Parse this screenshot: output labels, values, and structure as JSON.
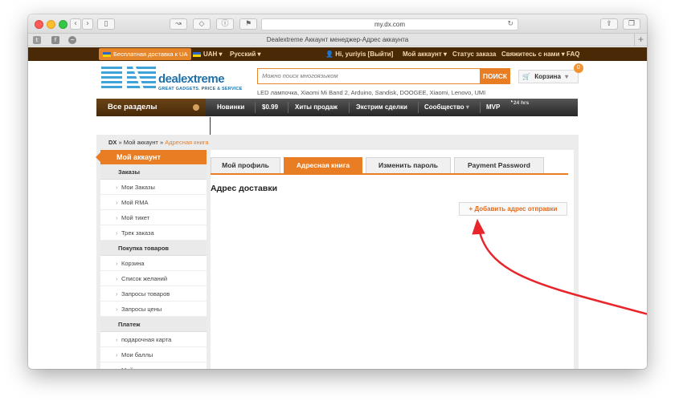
{
  "browser": {
    "url": "my.dx.com",
    "tab_title": "Dealextreme Аккаунт менеджер-Адрес аккаунта",
    "new_tab": "+"
  },
  "topbar": {
    "free_shipping": "Бесплатная доставка к UA",
    "currency": "UAH ▾",
    "language": "Русский ▾",
    "greeting": "Hi, yuriyis [Выйти]",
    "my_account": "Мой аккаунт ▾",
    "order_status": "Статус заказа",
    "contact": "Свяжитесь с нами ▾",
    "faq": "FAQ"
  },
  "header": {
    "logo_main": "dealextreme",
    "logo_sub": "GREAT GADGETS. PRICE & SERVICE",
    "search_placeholder": "Можно поиск многоязыком",
    "search_button": "ПОИСК",
    "keywords": "LED лампочка, Xiaomi Mi Band 2, Arduino, Sandisk, DOOGEE, Xiaomi, Lenovo, UMI",
    "cart_label": "Корзина",
    "cart_count": "0"
  },
  "nav": {
    "all_categories": "Все разделы",
    "items": [
      "Новинки",
      "$0.99",
      "Хиты продаж",
      "Экстрим сделки",
      "Сообщество",
      "MVP"
    ],
    "hours": "24 hrs"
  },
  "breadcrumb": {
    "home": "DX",
    "sep": "»",
    "account": "Мой аккаунт",
    "current": "Адресная книга"
  },
  "sidebar": {
    "title": "Мой аккаунт",
    "sections": [
      {
        "title": "Заказы",
        "items": [
          "Мои Заказы",
          "Мой RMA",
          "Мой тикет",
          "Трек заказа"
        ]
      },
      {
        "title": "Покупка товаров",
        "items": [
          "Корзина",
          "Список желаний",
          "Запросы товаров",
          "Запросы цены"
        ]
      },
      {
        "title": "Платеж",
        "items": [
          "подарочная карта",
          "Мои баллы",
          "Мой счет"
        ]
      }
    ]
  },
  "panel": {
    "tabs": [
      "Мой профиль",
      "Адресная книга",
      "Изменить пароль",
      "Payment Password"
    ],
    "active_tab": "Адресная книга",
    "section_title": "Адрес доставки",
    "add_button": "+ Добавить адрес отправки"
  },
  "colors": {
    "accent": "#e97d23",
    "topbar": "#4a2906",
    "annotation_arrow": "#e8252b"
  }
}
